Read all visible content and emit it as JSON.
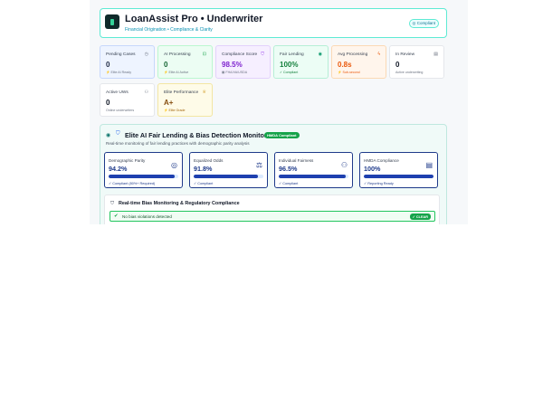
{
  "header": {
    "brand": "LoanAssist Pro • Underwriter",
    "tagline": "Financial Origination • Compliance & Clarity",
    "badge": "Compliant",
    "logo_icon": "shield-logo-icon"
  },
  "stats": [
    {
      "label": "Pending Cases",
      "value": "0",
      "sub": "⚡ Elite AI Ready",
      "icon": "clock-icon",
      "color": "#1f2a44"
    },
    {
      "label": "AI Processing",
      "value": "0",
      "sub": "⚡ Elite AI Active",
      "icon": "robot-icon",
      "color": "#166534"
    },
    {
      "label": "Compliance Score",
      "value": "98.5%",
      "sub": "▦ FHA/VA/USDA",
      "icon": "shield-icon",
      "color": "#7e22ce"
    },
    {
      "label": "Fair Lending",
      "value": "100%",
      "sub": "✓ Compliant",
      "icon": "eye-icon",
      "color": "#15803d"
    },
    {
      "label": "Avg Processing",
      "value": "0.8s",
      "sub": "⚡ Sub-second",
      "icon": "bolt-icon",
      "color": "#ea580c"
    },
    {
      "label": "In Review",
      "value": "0",
      "sub": "Active underwriting",
      "icon": "file-icon",
      "color": "#111827"
    },
    {
      "label": "Active UWs",
      "value": "0",
      "sub": "Online underwriters",
      "icon": "users-icon",
      "color": "#111827"
    },
    {
      "label": "Elite Performance",
      "value": "A+",
      "sub": "⚡ Elite Grade",
      "icon": "trophy-icon",
      "color": "#854d0e"
    }
  ],
  "monitor": {
    "title": "Elite AI Fair Lending & Bias Detection Monitor",
    "badge": "HMDA Compliant",
    "description": "Real-time monitoring of fair lending practices with demographic parity analysis",
    "metrics": [
      {
        "label": "Demographic Parity",
        "value": "94.2%",
        "progress": 94.2,
        "sub": "✓ Compliant (80%+ Required)",
        "icon": "target-icon"
      },
      {
        "label": "Equalized Odds",
        "value": "91.8%",
        "progress": 91.8,
        "sub": "✓ Compliant",
        "icon": "scale-icon"
      },
      {
        "label": "Individual Fairness",
        "value": "96.5%",
        "progress": 96.5,
        "sub": "✓ Compliant",
        "icon": "people-icon"
      },
      {
        "label": "HMDA Compliance",
        "value": "100%",
        "progress": 100,
        "sub": "✓ Reporting Ready",
        "icon": "document-icon"
      }
    ],
    "realtime": {
      "title": "Real-time Bias Monitoring & Regulatory Compliance",
      "status_text": "No bias violations detected",
      "status_badge": "✓ CLEAR"
    }
  }
}
